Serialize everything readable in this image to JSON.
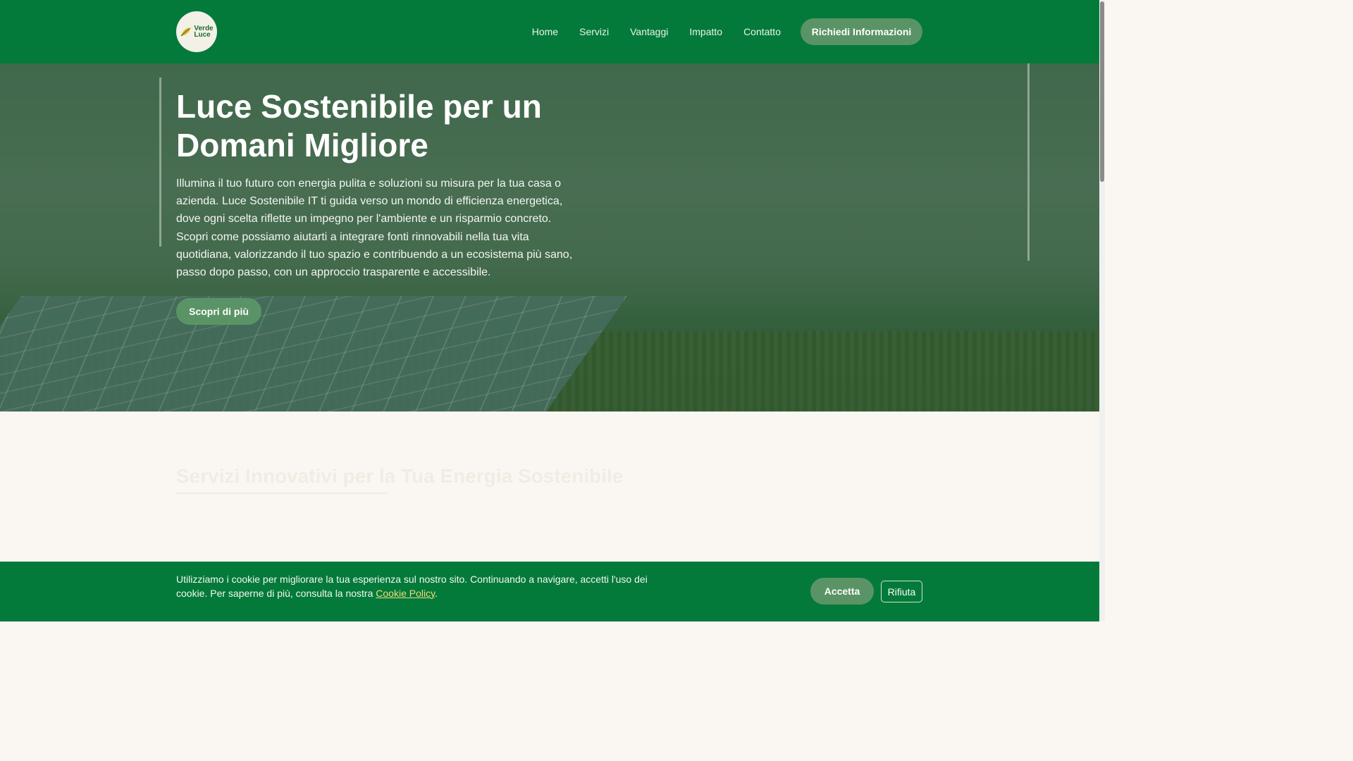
{
  "header": {
    "logo": {
      "line1": "Verde",
      "line2": "Luce"
    },
    "nav": [
      "Home",
      "Servizi",
      "Vantaggi",
      "Impatto",
      "Contatto"
    ],
    "cta_label": "Richiedi Informazioni"
  },
  "hero": {
    "title": "Luce Sostenibile per un Domani Migliore",
    "description": "Illumina il tuo futuro con energia pulita e soluzioni su misura per la tua casa o azienda. Luce Sostenibile IT ti guida verso un mondo di efficienza energetica, dove ogni scelta riflette un impegno per l'ambiente e un risparmio concreto. Scopri come possiamo aiutarti a integrare fonti rinnovabili nella tua vita quotidiana, valorizzando il tuo spazio e contribuendo a un ecosistema più sano, passo dopo passo, con un approccio trasparente e accessibile.",
    "button_label": "Scopri di più"
  },
  "section": {
    "title": "Servizi Innovativi per la Tua Energia Sostenibile"
  },
  "cookie": {
    "text": "Utilizziamo i cookie per migliorare la tua esperienza sul nostro sito. Continuando a navigare, accetti l'uso dei cookie. Per saperne di più, consulta la nostra ",
    "link_label": "Cookie Policy",
    "text_end": ".",
    "accept_label": "Accetta",
    "reject_label": "Rifiuta"
  },
  "colors": {
    "header_green": "#047a3a",
    "button_green": "#5a9466",
    "link_yellow": "#f3dc7e"
  }
}
